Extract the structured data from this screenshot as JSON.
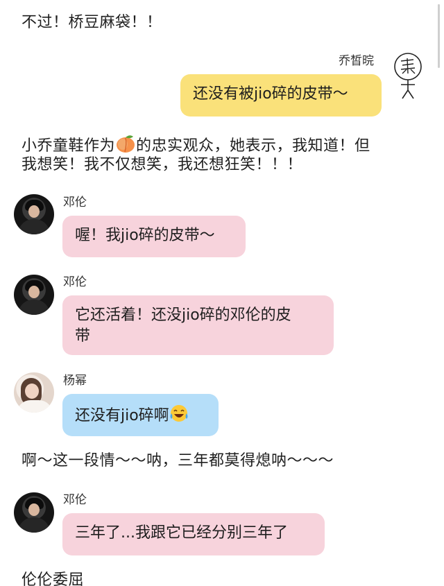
{
  "narrations": [
    "不过！桥豆麻袋！！",
    "小乔童鞋作为",
    "的忠实观众，她表示，我知道！但",
    "我想笑！我不仅想笑，我还想狂笑！！！",
    "啊～这一段情～～呐，三年都莫得熄呐～～～",
    "伦伦委屈"
  ],
  "messages": [
    {
      "sender": "乔皙晥",
      "text": "还没有被jio碎的皮带～"
    },
    {
      "sender": "邓伦",
      "text": "喔！我jio碎的皮带～"
    },
    {
      "sender": "邓伦",
      "line1": "它还活着！还没jio碎的邓伦的皮",
      "line2": "带"
    },
    {
      "sender": "杨幂",
      "text": "还没有jio碎啊"
    },
    {
      "sender": "邓伦",
      "text": "三年了...我跟它已经分别三年了"
    }
  ],
  "icons": {
    "peach": "peach-emoji",
    "laugh": "tears-of-joy-emoji",
    "doodle": "stick-figure-doodle"
  },
  "colors": {
    "pink_bubble": "#f7d3dc",
    "blue_bubble": "#b5def9",
    "yellow_bubble": "#fae17a"
  }
}
